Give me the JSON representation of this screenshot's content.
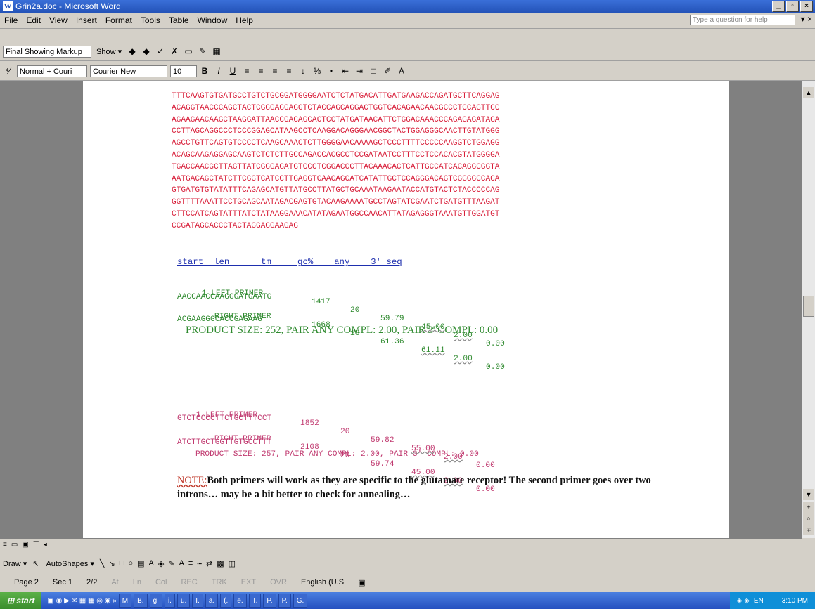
{
  "window": {
    "title": "Grin2a.doc - Microsoft Word",
    "controls": [
      "_",
      "▫",
      "×"
    ]
  },
  "menu": {
    "items": [
      "File",
      "Edit",
      "View",
      "Insert",
      "Format",
      "Tools",
      "Table",
      "Window",
      "Help"
    ],
    "help_placeholder": "Type a question for help",
    "close": "▾ ×"
  },
  "toolbar1": {
    "markup": "Final Showing Markup",
    "show": "Show ▾"
  },
  "toolbar2": {
    "style": "Normal + Couri",
    "font": "Courier New",
    "size": "10",
    "bold": "B",
    "italic": "I",
    "underline": "U"
  },
  "document": {
    "sequence_lines": [
      "TTTCAAGTGTGATGCCTGTCTGCGGATGGGGAATCTCTATGACATTGATGAAGACCAGATGCTTCAGGAG",
      "ACAGGTAACCCAGCTACTCGGGAGGAGGTCTACCAGCAGGACTGGTCACAGAACAACGCCCTCCAGTTCC",
      "AGAAGAACAAGCTAAGGATTAACCGACAGCACTCCTATGATAACATTCTGGACAAACCCAGAGAGATAGA",
      "CCTTAGCAGGCCCTCCCGGAGCATAAGCCTCAAGGACAGGGAACGGCTACTGGAGGGCAACTTGTATGGG",
      "AGCCTGTTCAGTGTCCCCTCAAGCAAACTCTTGGGGAACAAAAGCTCCCTTTTCCCCCAAGGTCTGGAGG",
      "ACAGCAAGAGGAGCAAGTCTCTCTTGCCAGACCACGCCTCCGATAATCCTTTCCTCCACACGTATGGGGA",
      "TGACCAACGCTTAGTTATCGGGAGATGTCCCTCGGACCCTTACAAACACTCATTGCCATCACAGGCGGTA",
      "AATGACAGCTATCTTCGGTCATCCTTGAGGTCAACAGCATCATATTGCTCCAGGGACAGTCGGGGCCACA",
      "GTGATGTGTATATTTCAGAGCATGTTATGCCTTATGCTGCAAATAAGAATACCATGTACTCTACCCCCAG",
      "GGTTTTAAATTCCTGCAGCAATAGACGAGTGTACAAGAAAATGCCTAGTATCGAATCTGATGTTTAAGAT",
      "CTTCCATCAGTATTTATCTATAAGGAAACATATAGAATGGCCAACATTATAGAGGGTAAATGTTGGATGT",
      "CCGATAGCACCCTACTAGGAGGAAGAG"
    ],
    "header": "start  len      tm     gc%    any    3' seq",
    "pair1": {
      "left": {
        "label": "1 LEFT PRIMER",
        "start": "1417",
        "len": "20",
        "tm": "59.79",
        "gc": "45.00",
        "any": "2.00",
        "three": "0.00",
        "seq": "AACCAACGAAGGGATGAATG"
      },
      "right": {
        "label": "RIGHT PRIMER",
        "start": "1668",
        "len": "18",
        "tm": "61.36",
        "gc": "61.11",
        "any": "2.00",
        "three": "0.00",
        "seq": "ACGAAGGGCACCGAGAAG"
      },
      "product": "PRODUCT SIZE: 252, PAIR ANY COMPL: 2.00, PAIR 3' COMPL: 0.00"
    },
    "pair2": {
      "left": {
        "label": "1 LEFT PRIMER",
        "start": "1852",
        "len": "20",
        "tm": "59.82",
        "gc": "55.00",
        "any": "2.00",
        "three": "0.00",
        "seq": "GTCTCCCCTTCTGCTTTCCT"
      },
      "right": {
        "label": "RIGHT PRIMER",
        "start": "2108",
        "len": "20",
        "tm": "59.74",
        "gc": "45.00",
        "any": "2.00",
        "three": "0.00",
        "seq": "ATCTTGCTGGTTGTGCCTTT"
      },
      "product": "PRODUCT SIZE: 257, PAIR ANY COMPL: 2.00, PAIR 3' COMPL: 0.00"
    },
    "note": {
      "label": "NOTE:",
      "text": "Both primers will work as they are specific to the glutamate receptor! The second primer goes over two introns… may be a bit better to check for annealing…"
    }
  },
  "drawbar": {
    "draw": "Draw ▾",
    "autoshapes": "AutoShapes ▾"
  },
  "status": {
    "page": "Page 2",
    "sec": "Sec 1",
    "pages": "2/2",
    "at": "At",
    "ln": "Ln",
    "col": "Col",
    "rec": "REC",
    "trk": "TRK",
    "ext": "EXT",
    "ovr": "OVR",
    "lang": "English (U.S"
  },
  "taskbar": {
    "start": "start",
    "tasks": [
      "M",
      "B.",
      "g.",
      "i.",
      "u.",
      "I.",
      "a.",
      "(.",
      "e.",
      "T.",
      "P.",
      "P.",
      "G."
    ],
    "lang": "EN",
    "time": "3:10 PM"
  }
}
